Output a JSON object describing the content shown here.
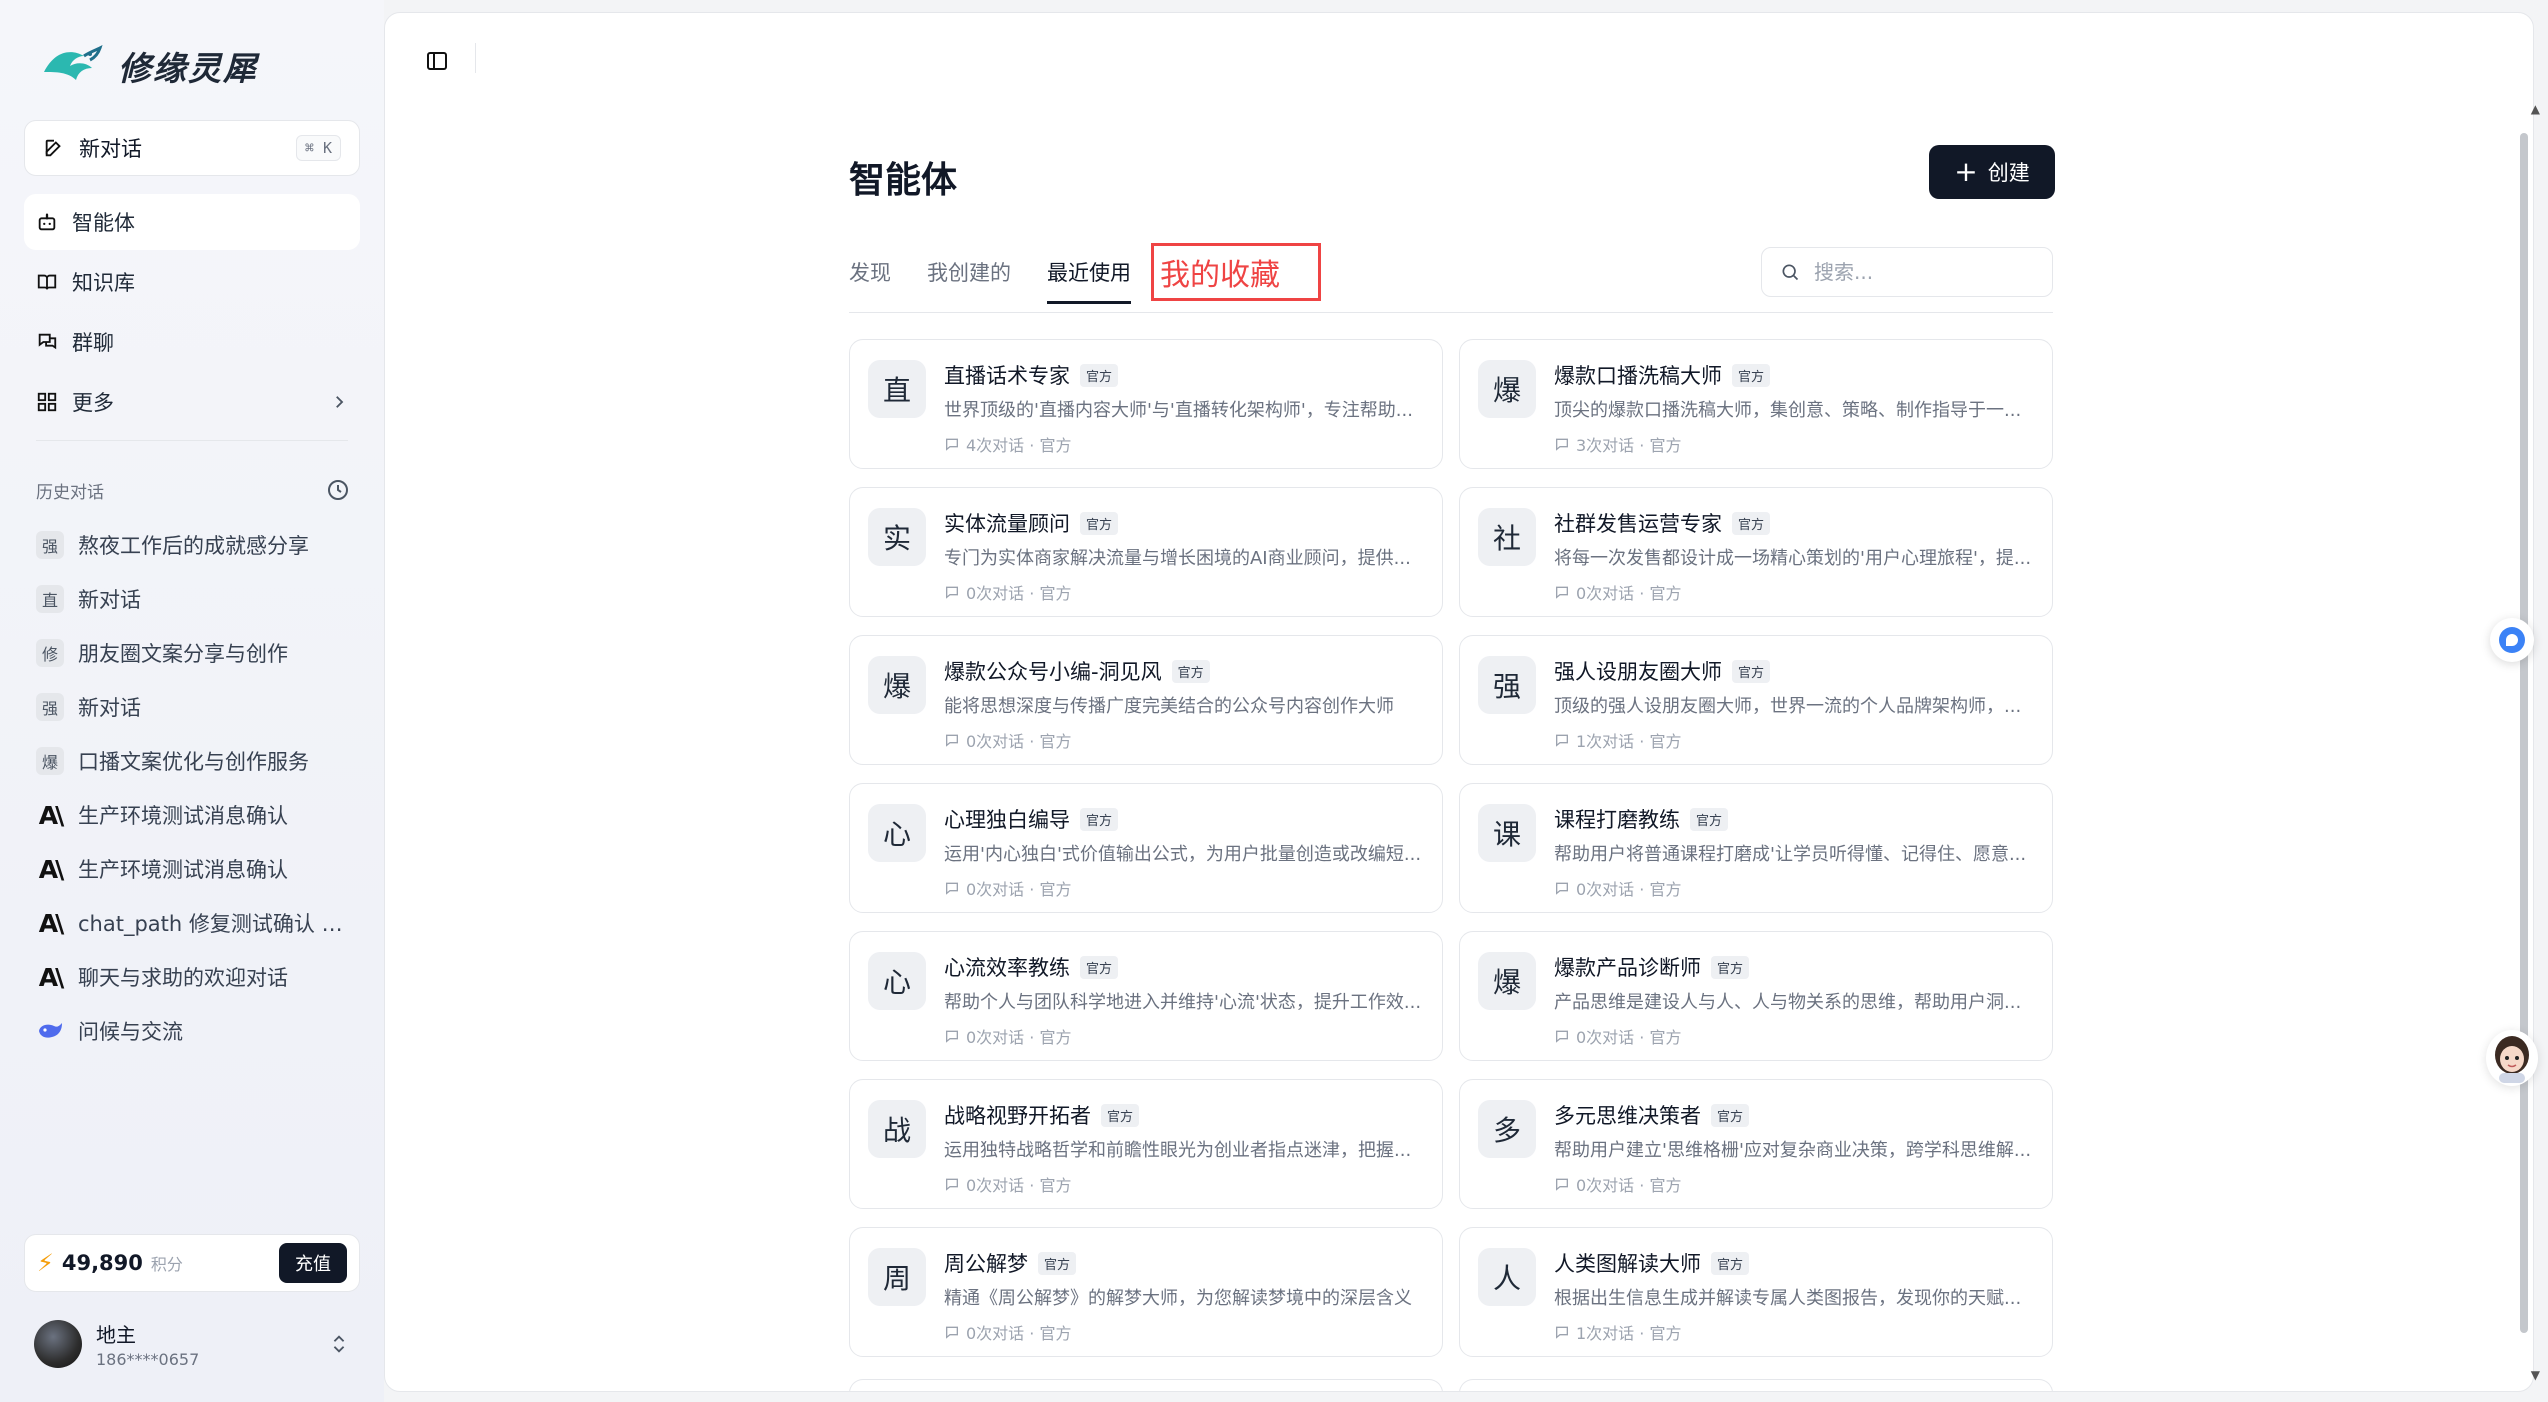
{
  "sidebar": {
    "logo_text": "修缘灵犀",
    "new_chat_label": "新对话",
    "new_chat_shortcut": "⌘ K",
    "nav": [
      {
        "label": "智能体",
        "icon": "bot-icon",
        "active": true
      },
      {
        "label": "知识库",
        "icon": "book-icon",
        "active": false
      },
      {
        "label": "群聊",
        "icon": "chat-group-icon",
        "active": false
      },
      {
        "label": "更多",
        "icon": "grid-icon",
        "active": false
      }
    ],
    "history_title": "历史对话",
    "history": [
      {
        "avatar": "强",
        "title": "熬夜工作后的成就感分享"
      },
      {
        "avatar": "直",
        "title": "新对话"
      },
      {
        "avatar": "修",
        "title": "朋友圈文案分享与创作"
      },
      {
        "avatar": "强",
        "title": "新对话"
      },
      {
        "avatar": "爆",
        "title": "口播文案优化与创作服务"
      },
      {
        "avatar": "AI",
        "title": "生产环境测试消息确认"
      },
      {
        "avatar": "AI",
        "title": "生产环境测试消息确认"
      },
      {
        "avatar": "AI",
        "title": "chat_path 修复测试确认 v..."
      },
      {
        "avatar": "AI",
        "title": "聊天与求助的欢迎对话"
      },
      {
        "avatar": "whale",
        "title": "问候与交流"
      }
    ],
    "points_value": "49,890",
    "points_unit": "积分",
    "recharge_label": "充值",
    "user_name": "地主",
    "user_phone": "186****0657"
  },
  "main": {
    "title": "智能体",
    "create_label": "创建",
    "tabs": [
      "发现",
      "我创建的",
      "最近使用"
    ],
    "highlight_tab": "我的收藏",
    "search_placeholder": "搜索...",
    "badge_label": "官方",
    "agents": [
      {
        "icon": "直",
        "name": "直播话术专家",
        "desc": "世界顶级的'直播内容大师'与'直播转化架构师'，专注帮助...",
        "meta": "4次对话 · 官方"
      },
      {
        "icon": "爆",
        "name": "爆款口播洗稿大师",
        "desc": "顶尖的爆款口播洗稿大师，集创意、策略、制作指导于一...",
        "meta": "3次对话 · 官方"
      },
      {
        "icon": "实",
        "name": "实体流量顾问",
        "desc": "专门为实体商家解决流量与增长困境的AI商业顾问，提供...",
        "meta": "0次对话 · 官方"
      },
      {
        "icon": "社",
        "name": "社群发售运营专家",
        "desc": "将每一次发售都设计成一场精心策划的'用户心理旅程'，提...",
        "meta": "0次对话 · 官方"
      },
      {
        "icon": "爆",
        "name": "爆款公众号小编-洞见风",
        "desc": "能将思想深度与传播广度完美结合的公众号内容创作大师",
        "meta": "0次对话 · 官方"
      },
      {
        "icon": "强",
        "name": "强人设朋友圈大师",
        "desc": "顶级的强人设朋友圈大师，世界一流的个人品牌架构师，...",
        "meta": "1次对话 · 官方"
      },
      {
        "icon": "心",
        "name": "心理独白编导",
        "desc": "运用'内心独白'式价值输出公式，为用户批量创造或改编短...",
        "meta": "0次对话 · 官方"
      },
      {
        "icon": "课",
        "name": "课程打磨教练",
        "desc": "帮助用户将普通课程打磨成'让学员听得懂、记得住、愿意...",
        "meta": "0次对话 · 官方"
      },
      {
        "icon": "心",
        "name": "心流效率教练",
        "desc": "帮助个人与团队科学地进入并维持'心流'状态，提升工作效...",
        "meta": "0次对话 · 官方"
      },
      {
        "icon": "爆",
        "name": "爆款产品诊断师",
        "desc": "产品思维是建设人与人、人与物关系的思维，帮助用户洞...",
        "meta": "0次对话 · 官方"
      },
      {
        "icon": "战",
        "name": "战略视野开拓者",
        "desc": "运用独特战略哲学和前瞻性眼光为创业者指点迷津，把握...",
        "meta": "0次对话 · 官方"
      },
      {
        "icon": "多",
        "name": "多元思维决策者",
        "desc": "帮助用户建立'思维格栅'应对复杂商业决策，跨学科思维解...",
        "meta": "0次对话 · 官方"
      },
      {
        "icon": "周",
        "name": "周公解梦",
        "desc": "精通《周公解梦》的解梦大师，为您解读梦境中的深层含义",
        "meta": "0次对话 · 官方"
      },
      {
        "icon": "人",
        "name": "人类图解读大师",
        "desc": "根据出生信息生成并解读专属人类图报告，发现你的天赋...",
        "meta": "1次对话 · 官方"
      }
    ]
  },
  "colors": {
    "accent_dark": "#111827",
    "highlight_red": "#ef4444",
    "points_bolt": "#f59e0b"
  }
}
